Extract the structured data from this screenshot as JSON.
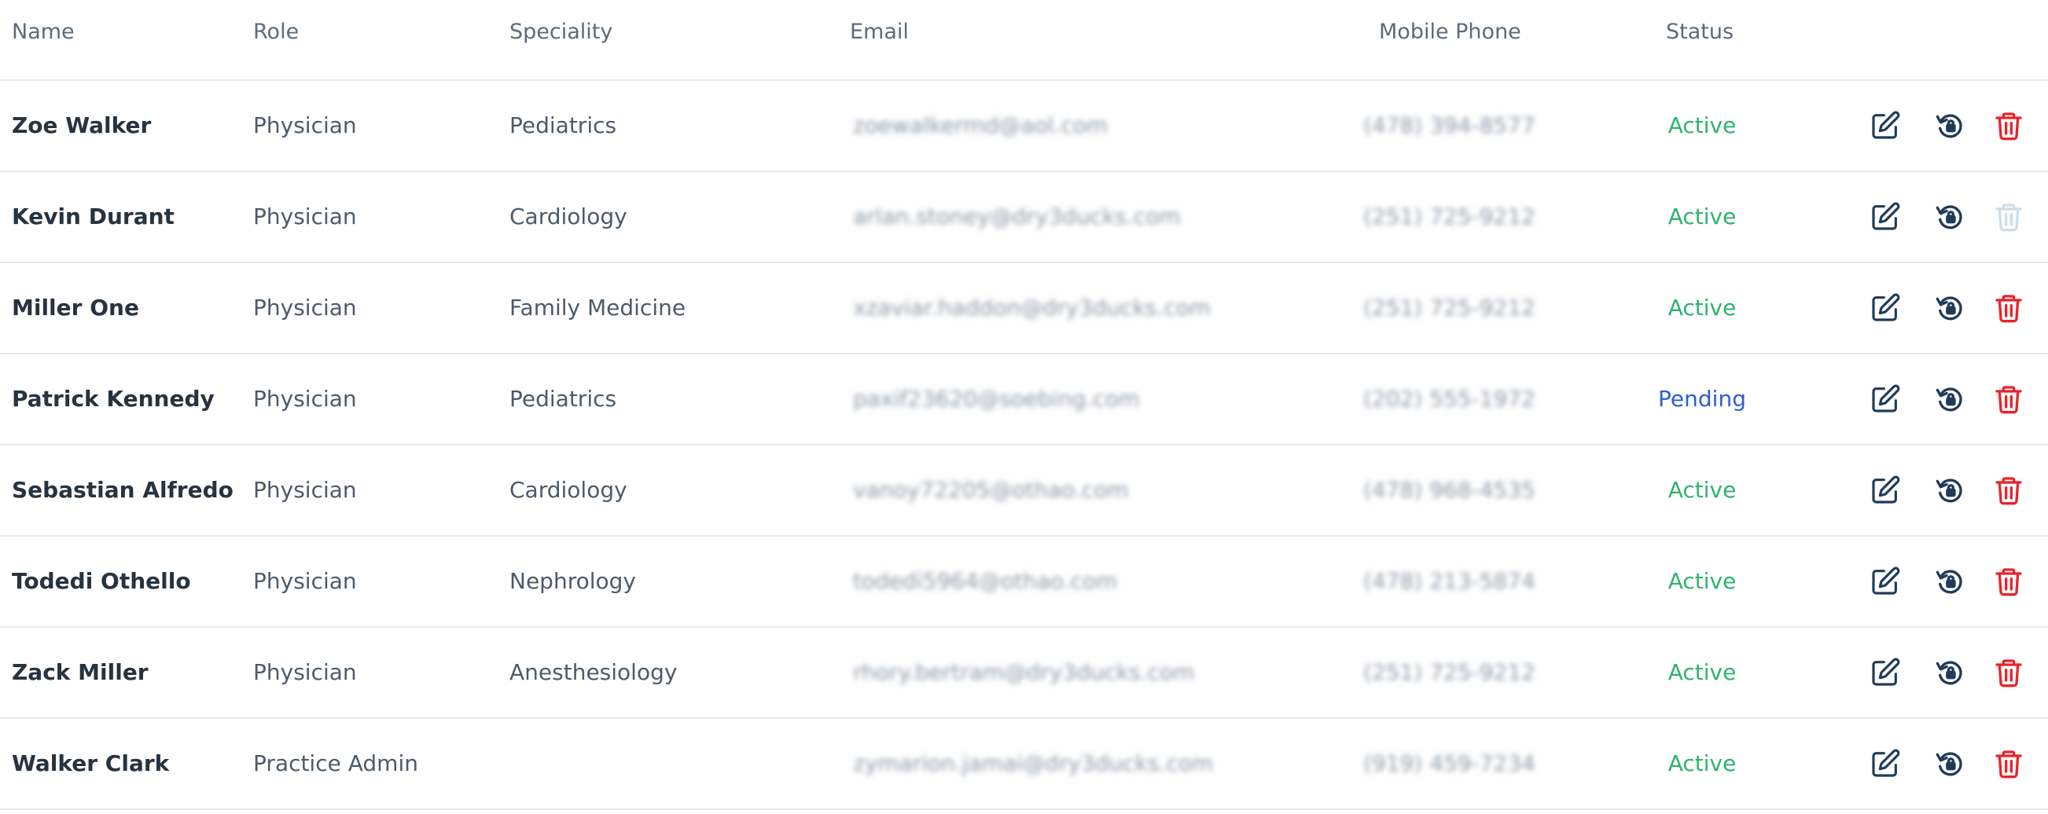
{
  "columns": {
    "name": "Name",
    "role": "Role",
    "speciality": "Speciality",
    "email": "Email",
    "mobile_phone": "Mobile Phone",
    "status": "Status"
  },
  "rows": [
    {
      "name": "Zoe Walker",
      "role": "Physician",
      "speciality": "Pediatrics",
      "email": "zoewalkermd@aol.com",
      "phone": "(478) 394-8577",
      "status": "Active",
      "status_kind": "active",
      "delete_enabled": true
    },
    {
      "name": "Kevin Durant",
      "role": "Physician",
      "speciality": "Cardiology",
      "email": "arlan.stoney@dry3ducks.com",
      "phone": "(251) 725-9212",
      "status": "Active",
      "status_kind": "active",
      "delete_enabled": false
    },
    {
      "name": "Miller One",
      "role": "Physician",
      "speciality": "Family Medicine",
      "email": "xzaviar.haddon@dry3ducks.com",
      "phone": "(251) 725-9212",
      "status": "Active",
      "status_kind": "active",
      "delete_enabled": true
    },
    {
      "name": "Patrick Kennedy",
      "role": "Physician",
      "speciality": "Pediatrics",
      "email": "paxif23620@soebing.com",
      "phone": "(202) 555-1972",
      "status": "Pending",
      "status_kind": "pending",
      "delete_enabled": true
    },
    {
      "name": "Sebastian Alfredo",
      "role": "Physician",
      "speciality": "Cardiology",
      "email": "vanoy72205@othao.com",
      "phone": "(478) 968-4535",
      "status": "Active",
      "status_kind": "active",
      "delete_enabled": true
    },
    {
      "name": "Todedi Othello",
      "role": "Physician",
      "speciality": "Nephrology",
      "email": "todedi5964@othao.com",
      "phone": "(478) 213-5874",
      "status": "Active",
      "status_kind": "active",
      "delete_enabled": true
    },
    {
      "name": "Zack Miller",
      "role": "Physician",
      "speciality": "Anesthesiology",
      "email": "rhory.bertram@dry3ducks.com",
      "phone": "(251) 725-9212",
      "status": "Active",
      "status_kind": "active",
      "delete_enabled": true
    },
    {
      "name": "Walker Clark",
      "role": "Practice Admin",
      "speciality": "",
      "email": "zymarion.jamai@dry3ducks.com",
      "phone": "(919) 459-7234",
      "status": "Active",
      "status_kind": "active",
      "delete_enabled": true
    }
  ],
  "icons": {
    "edit": "edit-icon",
    "restore": "reset-password-icon",
    "delete": "trash-icon"
  },
  "colors": {
    "active": "#2fb36e",
    "pending": "#2d5fd1",
    "delete": "#e8242b",
    "icon_dark": "#1f3b5a",
    "divider": "#e2ecef"
  }
}
